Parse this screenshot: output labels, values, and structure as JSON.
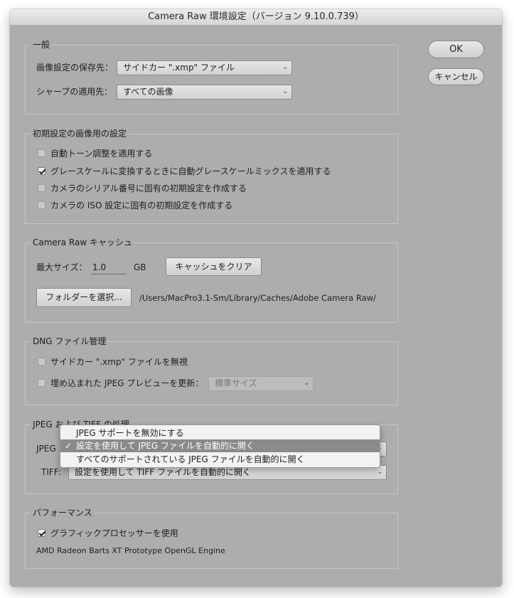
{
  "window": {
    "title": "Camera Raw 環境設定（バージョン 9.10.0.739）"
  },
  "buttons": {
    "ok": "OK",
    "cancel": "キャンセル"
  },
  "general": {
    "title": "一般",
    "save_label": "画像設定の保存先：",
    "save_value": "サイドカー \".xmp\" ファイル",
    "sharpen_label": "シャープの適用先：",
    "sharpen_value": "すべての画像"
  },
  "defaults": {
    "title": "初期設定の画像用の設定",
    "items": [
      {
        "label": "自動トーン調整を適用する",
        "checked": false
      },
      {
        "label": "グレースケールに変換するときに自動グレースケールミックスを適用する",
        "checked": true
      },
      {
        "label": "カメラのシリアル番号に固有の初期設定を作成する",
        "checked": false
      },
      {
        "label": "カメラの ISO 設定に固有の初期設定を作成する",
        "checked": false
      }
    ]
  },
  "cache": {
    "title": "Camera Raw キャッシュ",
    "max_label": "最大サイズ：",
    "max_value": "1.0",
    "unit": "GB",
    "clear_button": "キャッシュをクリア",
    "folder_button": "フォルダーを選択...",
    "path": "/Users/MacPro3.1-Sm/Library/Caches/Adobe Camera Raw/"
  },
  "dng": {
    "title": "DNG ファイル管理",
    "ignore_label": "サイドカー \".xmp\" ファイルを無視",
    "ignore_checked": false,
    "update_label": "埋め込まれた JPEG プレビューを更新：",
    "update_checked": false,
    "update_value": "標準サイズ"
  },
  "jpeg_tiff": {
    "title": "JPEG および TIFF の処理",
    "jpeg_label": "JPEG",
    "tiff_label": "TIFF:",
    "tiff_value": "設定を使用して TIFF ファイルを自動的に開く",
    "menu_items": [
      {
        "label": "JPEG サポートを無効にする",
        "selected": false,
        "check": ""
      },
      {
        "label": "設定を使用して JPEG ファイルを自動的に開く",
        "selected": true,
        "check": "✓"
      },
      {
        "label": "すべてのサポートされている JPEG ファイルを自動的に開く",
        "selected": false,
        "check": ""
      }
    ]
  },
  "performance": {
    "title": "パフォーマンス",
    "gpu_label": "グラフィックプロセッサーを使用",
    "gpu_checked": true,
    "gpu_name": "AMD Radeon Barts XT Prototype OpenGL Engine"
  },
  "icons": {
    "chevron": "chevron-down-icon",
    "checkmark": "checkmark-icon"
  }
}
